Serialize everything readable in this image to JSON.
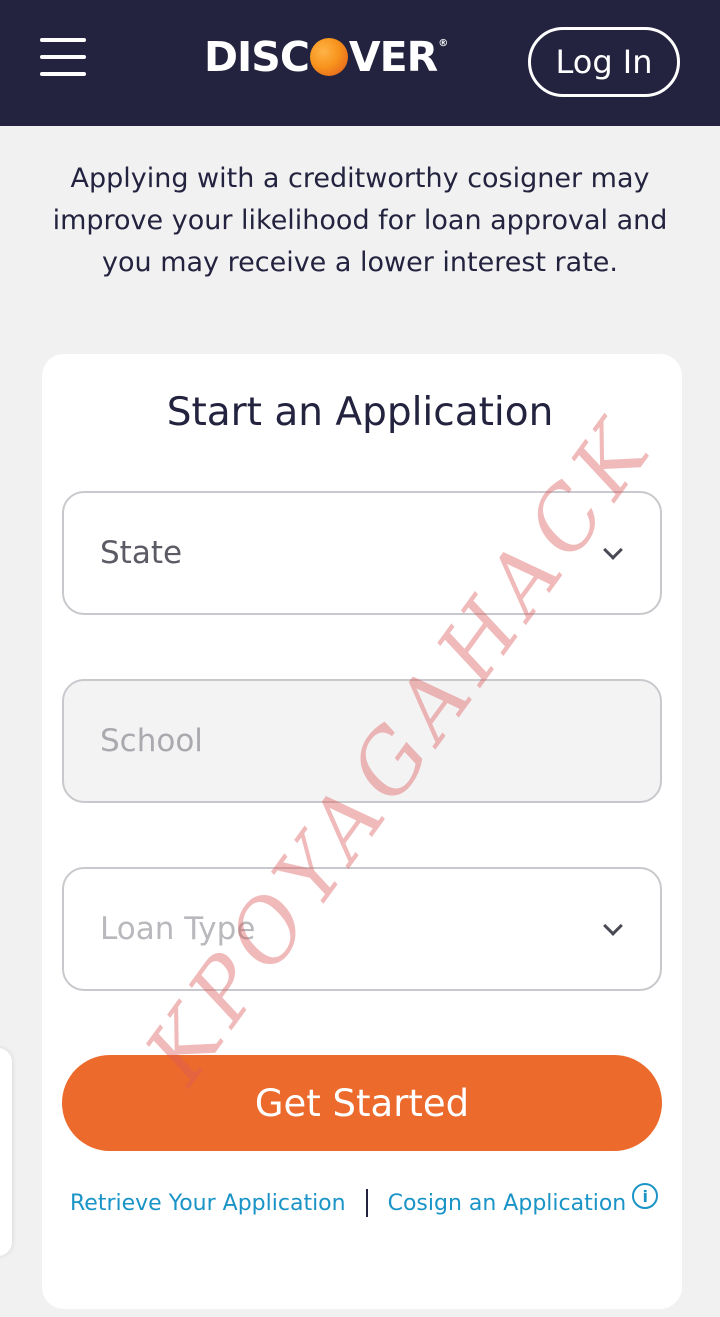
{
  "header": {
    "logo_text_left": "DISC",
    "logo_text_right": "VER",
    "logo_reg": "®",
    "login_label": "Log In"
  },
  "intro": {
    "text": "Applying with a creditworthy cosigner may improve your likelihood for loan approval and you may receive a lower interest rate."
  },
  "form": {
    "title": "Start an Application",
    "state_placeholder": "State",
    "school_placeholder": "School",
    "loan_type_placeholder": "Loan Type",
    "submit_label": "Get Started"
  },
  "links": {
    "retrieve": "Retrieve Your Application",
    "cosign": "Cosign an Application",
    "info_glyph": "i"
  },
  "watermark": "KPOYAGAHACK",
  "colors": {
    "header_bg": "#23233f",
    "accent": "#ec6a2c",
    "link": "#1a94c7"
  }
}
